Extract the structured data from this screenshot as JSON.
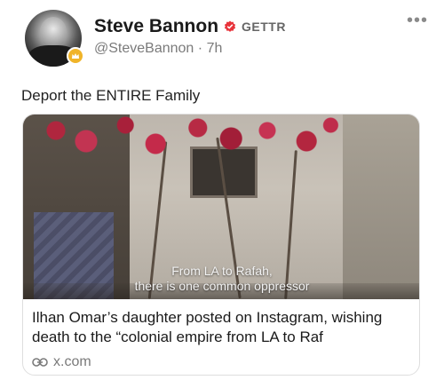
{
  "author": {
    "display_name": "Steve Bannon",
    "brand": "GETTR",
    "handle": "@SteveBannon",
    "separator": "·",
    "time": "7h"
  },
  "post": {
    "text": "Deport the ENTIRE Family"
  },
  "link_card": {
    "image_caption_line1": "From LA to Rafah,",
    "image_caption_line2": "there is one common oppressor",
    "title": "Ilhan Omar’s daughter posted on Instagram, wishing death to the “colonial empire from LA to Raf",
    "domain": "x.com",
    "icon": "link-icon"
  },
  "menu": {
    "more_label": "•••"
  },
  "colors": {
    "verified": "#e8333b",
    "badge": "#f0b429",
    "muted": "#7a7a7a"
  }
}
